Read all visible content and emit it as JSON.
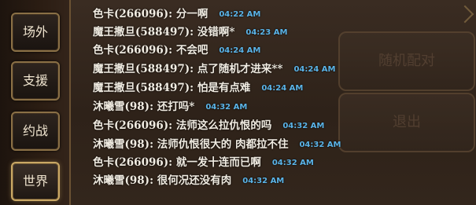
{
  "tabs": [
    {
      "label": "场外"
    },
    {
      "label": "支援"
    },
    {
      "label": "约战"
    },
    {
      "label": "世界",
      "active": true
    }
  ],
  "background_buttons": {
    "random_match": "随机配对",
    "exit": "退出"
  },
  "messages": [
    {
      "sender": "色卡(266096)",
      "text": "分一啊",
      "time": "04:22 AM"
    },
    {
      "sender": "魔王撒旦(588497)",
      "text": "没错啊*",
      "time": "04:23 AM"
    },
    {
      "sender": "色卡(266096)",
      "text": "不会吧",
      "time": "04:24 AM"
    },
    {
      "sender": "魔王撒旦(588497)",
      "text": "点了随机才进来**",
      "time": "04:24 AM"
    },
    {
      "sender": "魔王撒旦(588497)",
      "text": "怕是有点难",
      "time": "04:24 AM"
    },
    {
      "sender": "沐曦雪(98)",
      "text": "还打吗*",
      "time": "04:32 AM"
    },
    {
      "sender": "色卡(266096)",
      "text": "法师这么拉仇恨的吗",
      "time": "04:32 AM"
    },
    {
      "sender": "沐曦雪(98)",
      "text": "法师仇恨很大的 肉都拉不住",
      "time": "04:32 AM"
    },
    {
      "sender": "色卡(266096)",
      "text": "就一发十连而已啊",
      "time": "04:32 AM"
    },
    {
      "sender": "沐曦雪(98)",
      "text": "很何况还没有肉",
      "time": "04:32 AM"
    }
  ],
  "colors": {
    "message_text": "#f1ece2",
    "timestamp": "#5bb4e8",
    "tab_border": "#8a7046",
    "tab_active_border": "#c9a865"
  }
}
